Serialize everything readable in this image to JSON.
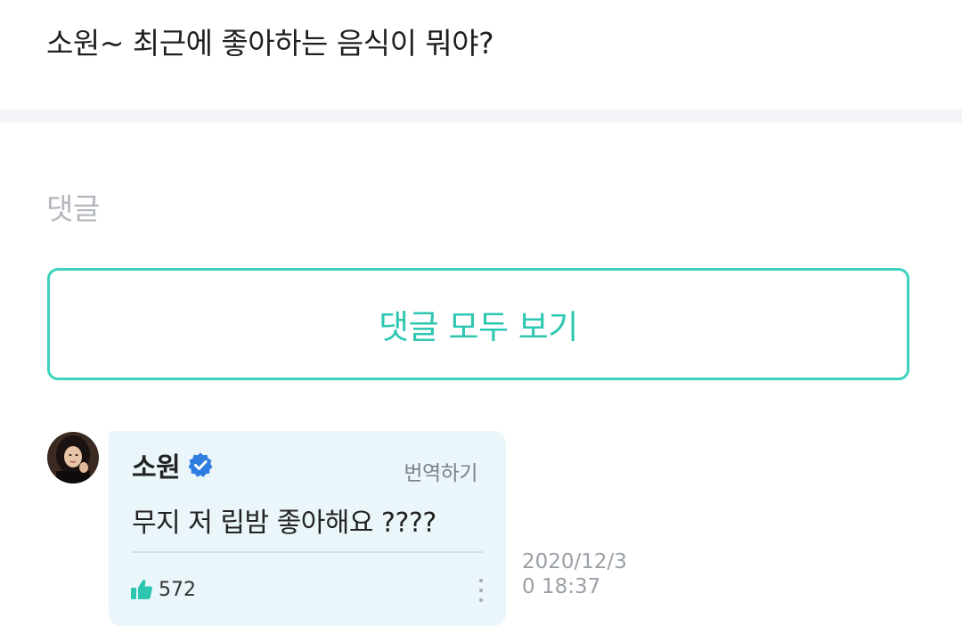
{
  "post": {
    "question": "소원~ 최근에 좋아하는 음식이 뭐야?"
  },
  "comments_section": {
    "heading": "댓글",
    "view_all_label": "댓글 모두 보기"
  },
  "comment": {
    "author": "소원",
    "verified_icon": "verified-badge-icon",
    "translate_label": "번역하기",
    "text": "무지 저 립밤 좋아해요 ????",
    "likes": "572",
    "like_icon": "thumbs-up-icon",
    "more_icon": "more-vertical-icon",
    "timestamp": "2020/12/30 18:37"
  },
  "colors": {
    "accent": "#2dc6b0",
    "card_background": "#ebf6fa",
    "verified_blue": "#2f7de1"
  }
}
